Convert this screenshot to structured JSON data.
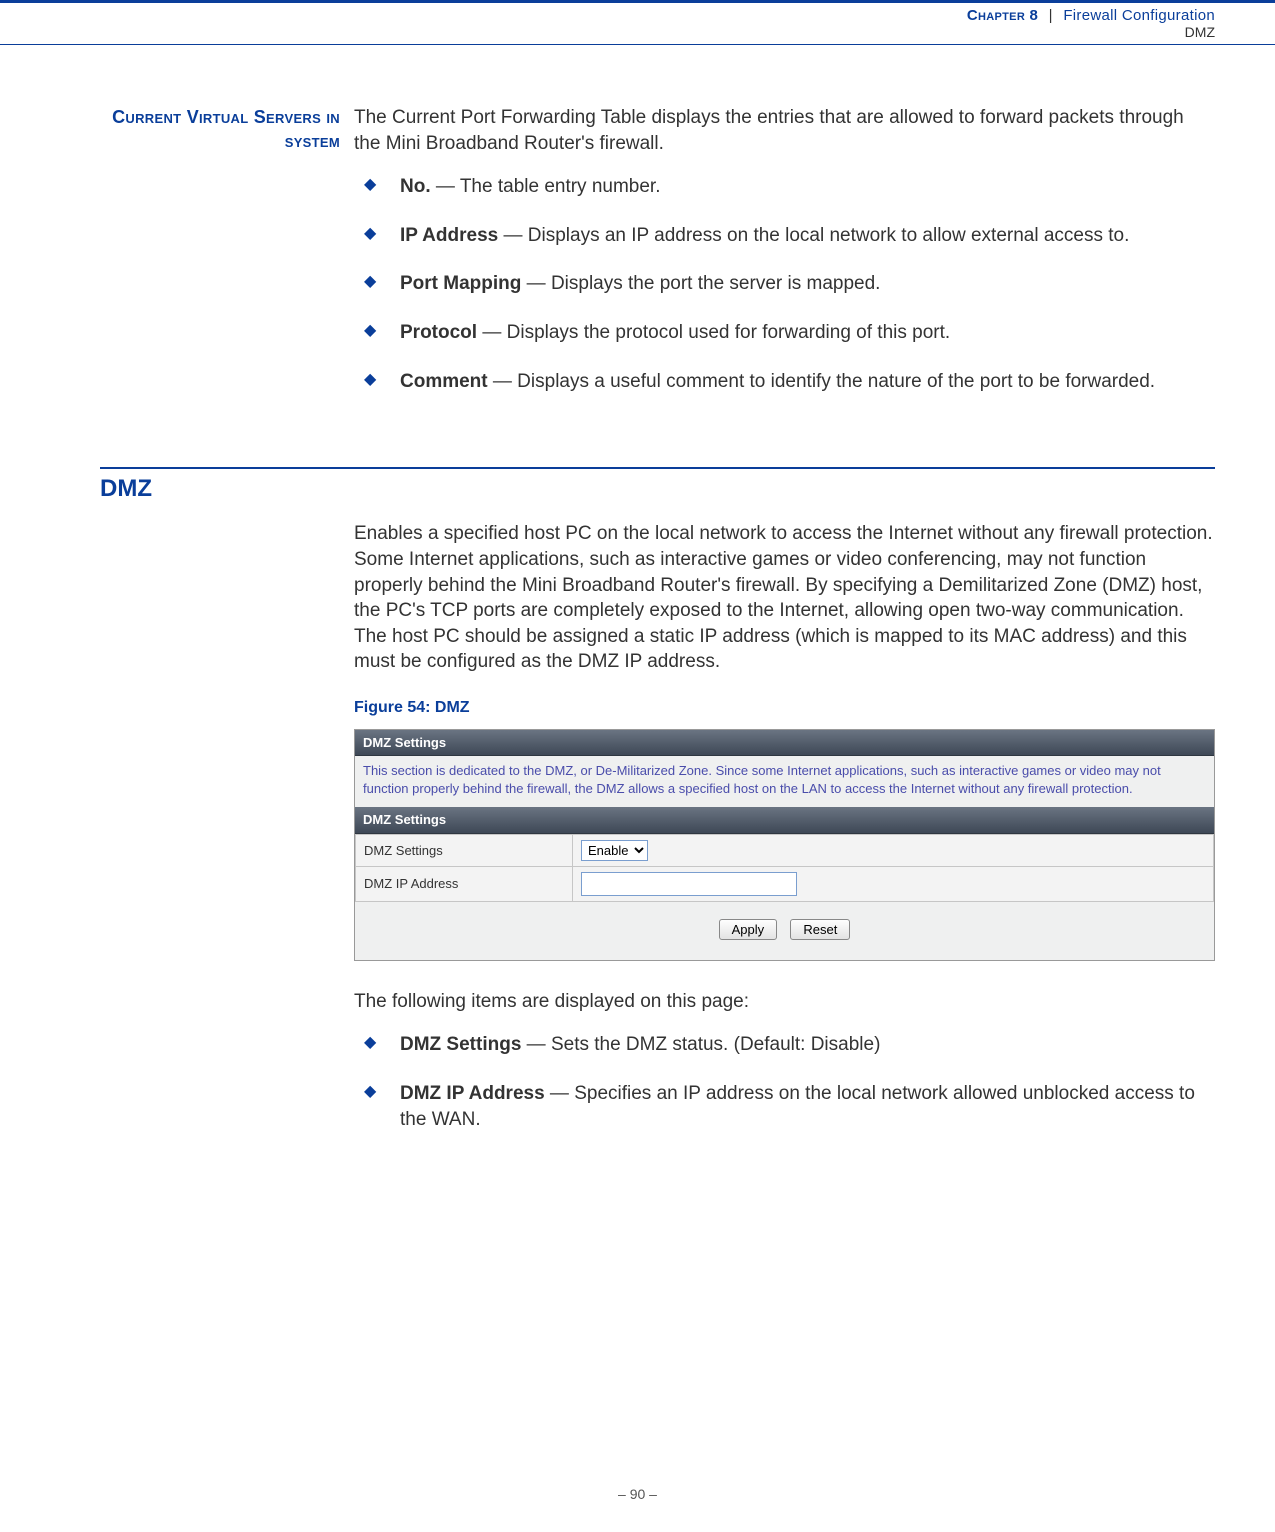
{
  "header": {
    "chapter_label": "Chapter 8",
    "chapter_title": "Firewall Configuration",
    "sub": "DMZ"
  },
  "section1": {
    "heading": "Current Virtual Servers in system",
    "intro": "The Current Port Forwarding Table displays the entries that are allowed to forward packets through the Mini Broadband Router's firewall.",
    "items": [
      {
        "bold": "No.",
        "rest": " — The table entry number."
      },
      {
        "bold": "IP Address",
        "rest": " — Displays an IP address on the local network to allow external access to."
      },
      {
        "bold": "Port Mapping",
        "rest": " — Displays the port the server is mapped."
      },
      {
        "bold": "Protocol",
        "rest": " — Displays the protocol used for forwarding of this port."
      },
      {
        "bold": "Comment",
        "rest": " — Displays a useful comment to identify the nature of the port to be forwarded."
      }
    ]
  },
  "section2": {
    "title": "DMZ",
    "para": "Enables a specified host PC on the local network to access the Internet without any firewall protection. Some Internet applications, such as interactive games or video conferencing, may not function properly behind the Mini Broadband Router's firewall. By specifying a Demilitarized Zone (DMZ) host, the PC's TCP ports are completely exposed to the Internet, allowing open two-way communication. The host PC should be assigned a static IP address (which is mapped to its MAC address) and this must be configured as the DMZ IP address.",
    "figure_label": "Figure 54:  DMZ",
    "figure": {
      "header1": "DMZ Settings",
      "desc": "This section is dedicated to the DMZ, or De-Militarized Zone. Since some Internet applications, such as interactive games or video may not function properly behind the firewall, the DMZ allows a specified host on the LAN to access the Internet without any firewall protection.",
      "header2": "DMZ Settings",
      "row1_label": "DMZ Settings",
      "row1_value": "Enable",
      "row2_label": "DMZ IP Address",
      "row2_value": "",
      "btn_apply": "Apply",
      "btn_reset": "Reset"
    },
    "after": "The following items are displayed on this page:",
    "items": [
      {
        "bold": "DMZ Settings",
        "rest": " — Sets the DMZ status. (Default: Disable)"
      },
      {
        "bold": "DMZ IP Address",
        "rest": " — Specifies an IP address on the local network allowed unblocked access to the WAN."
      }
    ]
  },
  "footer": "–  90  –"
}
